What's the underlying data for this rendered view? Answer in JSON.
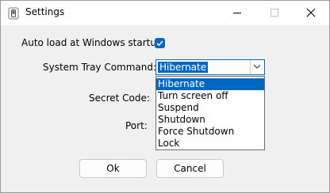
{
  "window": {
    "title": "Settings",
    "app_icon": "light-switch-icon",
    "controls": [
      "minimize-icon",
      "maximize-icon",
      "close-icon"
    ]
  },
  "form": {
    "autoload_label": "Auto load at Windows startup:",
    "autoload_checked": true,
    "tray_command_label": "System Tray Command:",
    "tray_command_value": "Hibernate",
    "tray_command_options": [
      "Hibernate",
      "Turn screen off",
      "Suspend",
      "Shutdown",
      "Force Shutdown",
      "Lock"
    ],
    "tray_command_highlighted": "Hibernate",
    "secret_code_label": "Secret Code:",
    "port_label": "Port:"
  },
  "buttons": {
    "ok_label": "Ok",
    "cancel_label": "Cancel"
  },
  "colors": {
    "accent": "#0067c0",
    "window_bg": "#f0f0f0",
    "titlebar_bg": "#ffffff"
  }
}
